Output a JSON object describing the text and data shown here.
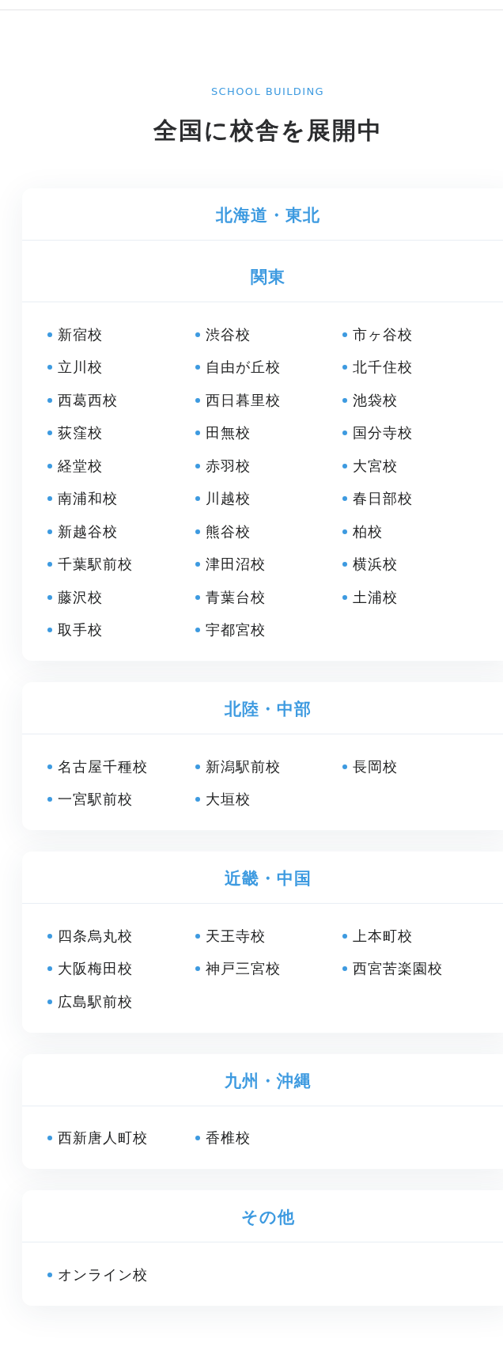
{
  "section": {
    "eyebrow": "SCHOOL BUILDING",
    "title": "全国に校舎を展開中"
  },
  "cards": [
    {
      "regions": [
        {
          "name": "北海道・東北"
        },
        {
          "name": "関東",
          "schools": [
            "新宿校",
            "渋谷校",
            "市ヶ谷校",
            "立川校",
            "自由が丘校",
            "北千住校",
            "西葛西校",
            "西日暮里校",
            "池袋校",
            "荻窪校",
            "田無校",
            "国分寺校",
            "経堂校",
            "赤羽校",
            "大宮校",
            "南浦和校",
            "川越校",
            "春日部校",
            "新越谷校",
            "熊谷校",
            "柏校",
            "千葉駅前校",
            "津田沼校",
            "横浜校",
            "藤沢校",
            "青葉台校",
            "土浦校",
            "取手校",
            "宇都宮校"
          ]
        }
      ]
    },
    {
      "regions": [
        {
          "name": "北陸・中部",
          "schools": [
            "名古屋千種校",
            "新潟駅前校",
            "長岡校",
            "一宮駅前校",
            "大垣校"
          ]
        }
      ]
    },
    {
      "regions": [
        {
          "name": "近畿・中国",
          "schools": [
            "四条烏丸校",
            "天王寺校",
            "上本町校",
            "大阪梅田校",
            "神戸三宮校",
            "西宮苦楽園校",
            "広島駅前校"
          ]
        }
      ]
    },
    {
      "regions": [
        {
          "name": "九州・沖縄",
          "schools": [
            "西新唐人町校",
            "香椎校"
          ]
        }
      ]
    },
    {
      "regions": [
        {
          "name": "その他",
          "schools": [
            "オンライン校"
          ]
        }
      ]
    }
  ]
}
